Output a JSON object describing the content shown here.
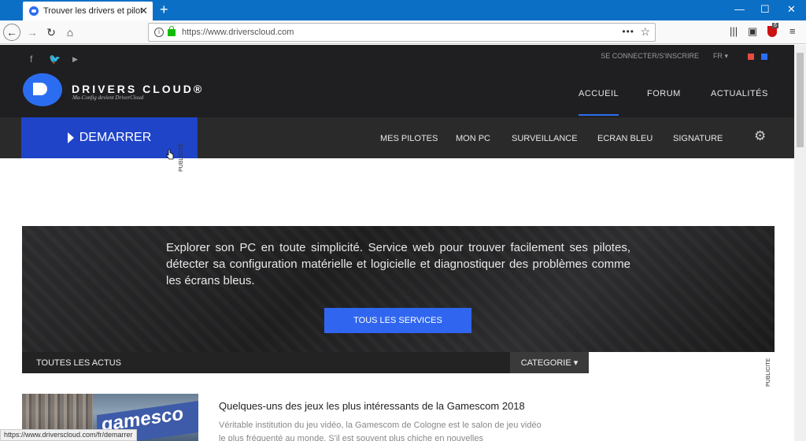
{
  "browser": {
    "tab_title": "Trouver les drivers et pilotes en",
    "url": "https://www.driverscloud.com",
    "status_url": "https://www.driverscloud.com/fr/demarrer",
    "badge_count": "6"
  },
  "site": {
    "top_links": {
      "connect": "SE CONNECTER/S'INSCRIRE",
      "lang": "FR ▾"
    },
    "logo": {
      "name": "DRIVERS CLOUD®",
      "tagline": "Ma-Config devient DriverCloud"
    },
    "main_nav": [
      "ACCUEIL",
      "FORUM",
      "ACTUALITÉS"
    ],
    "demarrer_label": "DEMARRER",
    "sub_nav": [
      "MES PILOTES",
      "MON PC",
      "SURVEILLANCE",
      "ECRAN BLEU",
      "SIGNATURE"
    ],
    "pub_label": "PUBLICITE",
    "hero": {
      "text": "Explorer son PC en toute simplicité. Service web pour trouver facilement ses pilotes, détecter sa configuration matérielle et logicielle et diagnostiquer des problèmes comme les écrans bleus.",
      "button": "TOUS LES SERVICES"
    },
    "actus": {
      "title": "TOUTES LES ACTUS",
      "category": "CATEGORIE ▾",
      "article_title": "Quelques-uns des jeux les plus intéressants de la Gamescom 2018",
      "article_text": "Véritable institution du jeu vidéo, la Gamescom de Cologne est le salon de jeu vidéo le plus fréquenté au monde. S'il est souvent plus chiche en nouvelles",
      "image_sign": "gamesco"
    }
  },
  "colors": {
    "accent": "#2b6df1",
    "demarrer": "#1f44c8",
    "header": "#1f1f21",
    "flag_red": "#e74c3c",
    "flag_blue": "#2b6df1"
  }
}
